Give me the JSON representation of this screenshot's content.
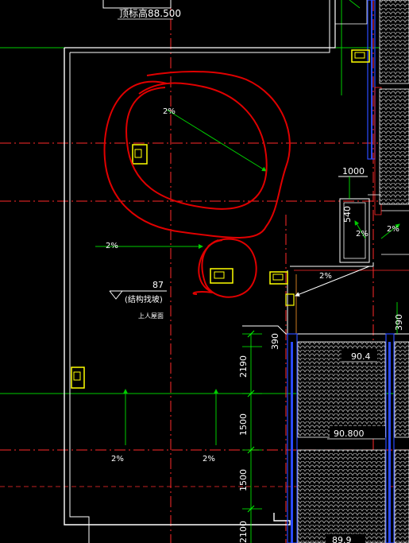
{
  "labels": {
    "top_height": "顶标高88.500",
    "slope_a": "2%",
    "slope_b": "2%",
    "slope_c": "2%",
    "slope_d": "2%",
    "slope_e": "2%",
    "slope_f": "2%",
    "slope_g": "2%",
    "level_87": "87",
    "structure_slope": "(结构找坡)",
    "roof_note": "上人屋面",
    "dim_1000": "1000",
    "dim_540": "540",
    "dim_390_left": "390",
    "dim_390_right": "390",
    "dim_2190": "2190",
    "dim_1500_a": "1500",
    "dim_1500_b": "1500",
    "dim_2100": "2100",
    "level_904": "90.4",
    "level_90800": "90.800",
    "level_899": "89.9"
  },
  "colors": {
    "background": "#000000",
    "wall": "#ffffff",
    "grid_red": "#ff2a2a",
    "grid_green": "#00cc00",
    "drain_yellow": "#ffff00",
    "annotation_circle": "#e00000",
    "window_blue": "#2a4bff",
    "dimension_green": "#00ff00",
    "hatch_gray": "#9a9a9a"
  }
}
